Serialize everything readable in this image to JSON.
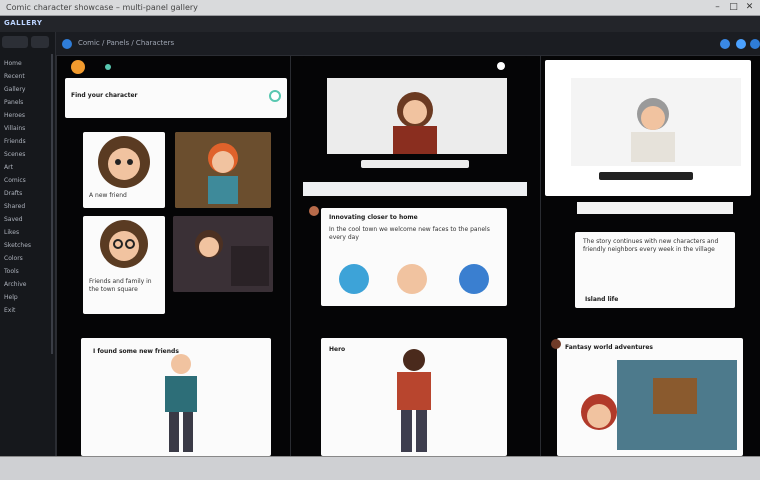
{
  "window": {
    "title": "Comic character showcase – multi-panel gallery",
    "minimize": "–",
    "maximize": "□",
    "close": "✕"
  },
  "app": {
    "name": "GALLERY"
  },
  "sidebar": {
    "items": [
      "Home",
      "Recent",
      "Gallery",
      "Panels",
      "Heroes",
      "Villains",
      "Friends",
      "Scenes",
      "Art",
      "Comics",
      "Drafts",
      "Shared",
      "Saved",
      "Likes",
      "Sketches",
      "Colors",
      "Tools",
      "Archive",
      "Help",
      "Exit"
    ]
  },
  "toolbar": {
    "path": "Comic / Panels / Characters"
  },
  "col1": {
    "search": {
      "label": "Find your character"
    },
    "card1": {
      "caption": "A new friend"
    },
    "card3": {
      "caption": "Friends and family in the town square"
    },
    "card5": {
      "title": "I found some new friends"
    }
  },
  "col2": {
    "post": {
      "title": "Innovating closer to home",
      "text": "In the cool town we welcome new faces to the panels every day"
    },
    "card": {
      "title": "Hero"
    }
  },
  "col3": {
    "post": {
      "text": "The story continues with new characters and friendly neighbors every week in the village",
      "footer": "Island life"
    },
    "card": {
      "title": "Fantasy world adventures"
    }
  },
  "colors": {
    "accent": "#2f7dd8",
    "panel": "#050506",
    "card": "#fbfbfb"
  }
}
